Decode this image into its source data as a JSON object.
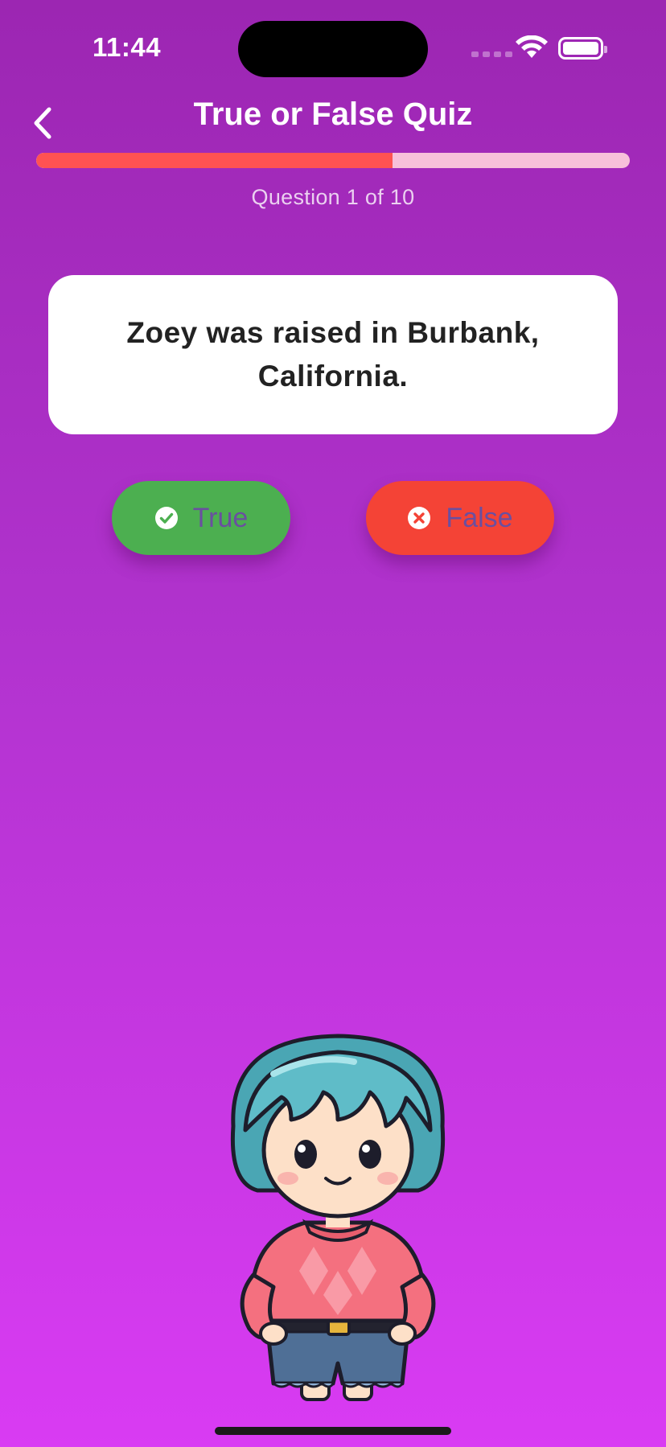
{
  "status_bar": {
    "time": "11:44"
  },
  "header": {
    "title": "True or False Quiz"
  },
  "progress": {
    "fraction": 0.6,
    "counter_text": "Question 1 of 10"
  },
  "question": {
    "text": "Zoey was raised in Burbank, California."
  },
  "answers": {
    "true_label": "True",
    "false_label": "False"
  },
  "icons": [
    "back-chevron-icon",
    "check-circle-icon",
    "x-circle-icon",
    "wifi-icon",
    "battery-icon"
  ],
  "colors": {
    "background_top": "#9c26b2",
    "background_bottom": "#d93bf3",
    "progress_fill": "#ff5252",
    "progress_track": "#f7c0da",
    "true_button": "#4caf50",
    "false_button": "#f44336",
    "answer_label": "#6a4fa0"
  }
}
